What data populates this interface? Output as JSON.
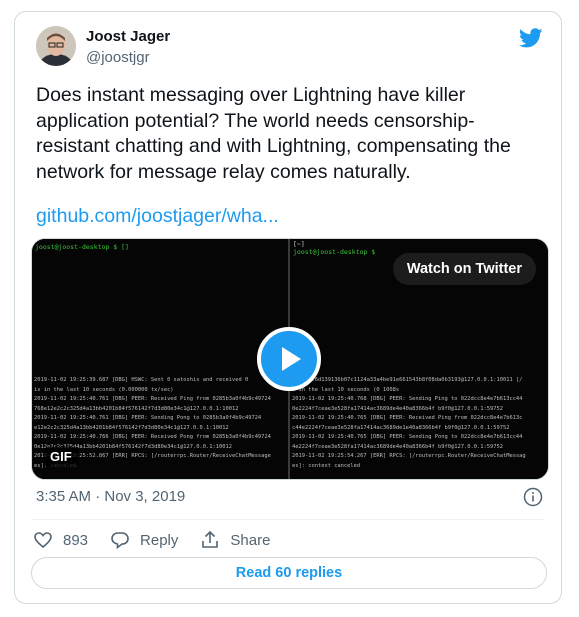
{
  "author": {
    "name": "Joost Jager",
    "handle": "@joostjgr"
  },
  "tweet": {
    "text": "Does instant messaging over Lightning have killer application potential? The world needs censorship-resistant chatting and with Lightning, compensating the network for message relay comes naturally.",
    "link": "github.com/joostjager/wha..."
  },
  "media": {
    "watch_label": "Watch on Twitter",
    "gif_label": "GIF",
    "left_prompt": "joost@joost-desktop $ []",
    "right_prompt": "joost@joost-desktop $",
    "right_title": "[~]",
    "left_log": "2019-11-02 19:25:39.687 [DBG] HSWC: Sent 0 satoshis and received 0\nis in the last 10 seconds (0.000000 tx/sec)\n2019-11-02 19:25:40.761 [DBG] PEER: Received Ping from 0285b3a0f4b9c49724\n768e12e2c2c325d4a13bb4201b84f576142f7d3d80e34c1@127.0.0.1:10012\n2019-11-02 19:25:40.761 [DBG] PEER: Sending Pong to 0285b3a0f4b9c49724\ne12e2c2c325d4a13bb4201b84f576142f7d3d80e34c1@127.0.0.1:10012\n2019-11-02 19:25:40.766 [DBG] PEER: Received Pong from 0285b3a0f4b9c49724\n0e12e2c2c325d4a13bb4201b84f576142f7d3d80e34c1@127.0.0.1:10012\n2019-11-02 19:25:52.867 [ERR] RPCS: [/routerrpc.Router/ReceiveChatMessage\nes]: canceled",
    "right_log": "02a5ebf6d139136b07c1124a33a4be91e661543b8f08da0b3193@127.0.0.1:10011 [/\ns in the last 10 seconds (0 1008s\n2019-11-02 19:25:40.768 [DBG] PEER: Sending Ping to 022dcc8e4e7b613cc44\n0e2224f7ceae3e528fa17414ac3689de4e40a8366b4f b9f0@127.0.0.1:59752\n2019-11-02 19:25:40.765 [DBG] PEER: Received Ping from 022dcc8e4e7b613c\nc44e2224f7ceae3e528fa17414ac3689de1e40a8366b4f b9f0@127.0.0.1:59752\n2019-11-02 19:25:40.765 [DBG] PEER: Sending Pong to 022dcc8e4e7b613cc44\n4e2224f7ceae3e528fa17414ac3689de4e40a8366b4f b9f0@127.0.0.1:59752\n2019-11-02 19:25:54.267 [ERR] RPCS: [/routerrpc.Router/ReceiveChatMessag\nes]: context canceled"
  },
  "meta": {
    "timestamp": "3:35 AM · Nov 3, 2019"
  },
  "actions": {
    "likes": "893",
    "reply_label": "Reply",
    "share_label": "Share"
  },
  "read_replies_label": "Read 60 replies",
  "colors": {
    "accent": "#1d9bf0",
    "muted": "#536471",
    "border": "#cfd9de"
  },
  "icons": [
    "avatar",
    "twitter-bird-icon",
    "play-icon",
    "info-icon",
    "heart-icon",
    "reply-icon",
    "share-icon"
  ]
}
